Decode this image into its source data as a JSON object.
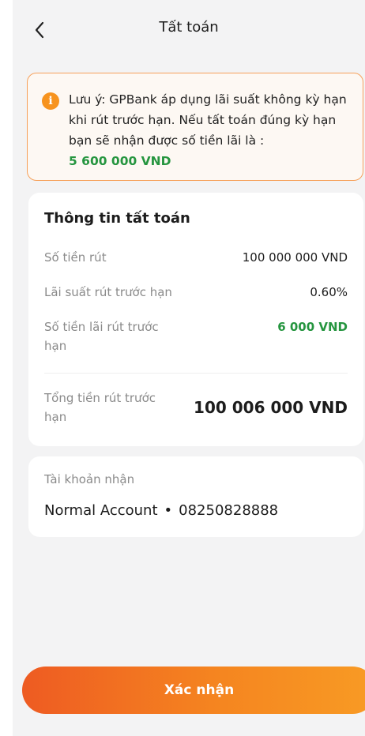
{
  "header": {
    "title": "Tất toán",
    "back_icon": "chevron-left-icon"
  },
  "notice": {
    "icon": "info-icon",
    "icon_glyph": "i",
    "text": "Lưu ý: GPBank áp dụng lãi suất không kỳ hạn khi rút trước hạn. Nếu tất toán đúng kỳ hạn bạn sẽ nhận được số tiền lãi là :",
    "amount": "5 600 000 VND"
  },
  "info": {
    "title": "Thông tin tất toán",
    "rows": [
      {
        "label": "Số tiền rút",
        "value": "100 000 000 VND"
      },
      {
        "label": "Lãi suất rút trước hạn",
        "value": "0.60%"
      },
      {
        "label": "Số tiền lãi rút trước hạn",
        "value": "6 000 VND"
      }
    ],
    "total_label": "Tổng tiền rút trước hạn",
    "total_value": "100 006 000 VND"
  },
  "account": {
    "label": "Tài khoản nhận",
    "name": "Normal Account",
    "separator": "•",
    "number": "08250828888"
  },
  "confirm_label": "Xác nhận",
  "colors": {
    "accent_orange": "#f58520",
    "green": "#25953f",
    "background": "#f3f3f4"
  }
}
